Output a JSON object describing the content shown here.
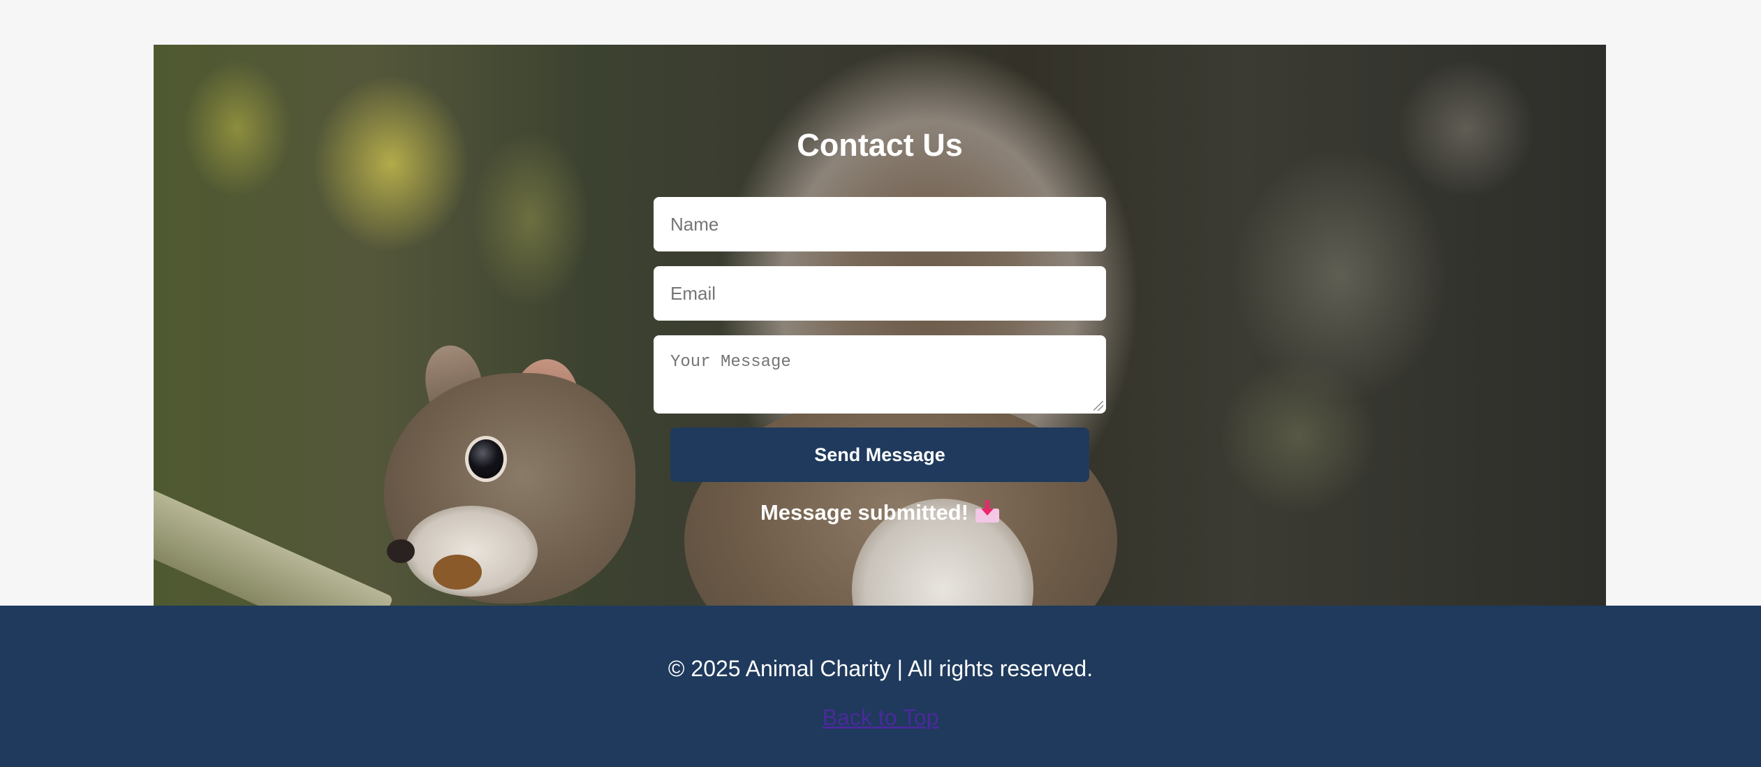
{
  "contact": {
    "title": "Contact Us",
    "name_placeholder": "Name",
    "email_placeholder": "Email",
    "message_placeholder": "Your Message",
    "send_label": "Send Message",
    "status_text": "Message submitted!",
    "status_icon": "inbox-tray-icon"
  },
  "footer": {
    "copyright": "© 2025 Animal Charity | All rights reserved.",
    "back_to_top": "Back to Top"
  },
  "colors": {
    "page_background": "#f6f6f6",
    "accent_navy": "#1f3a5c",
    "link_visited": "#4a2a9a",
    "text_on_dark": "#ffffff"
  }
}
